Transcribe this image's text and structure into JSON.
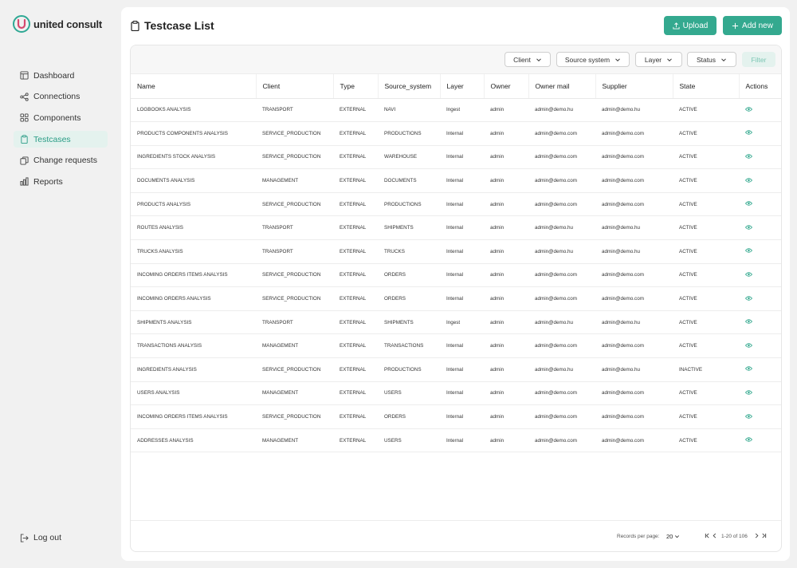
{
  "brand": {
    "name": "united consult",
    "accent": "#34a98f"
  },
  "sidebar": {
    "items": [
      {
        "label": "Dashboard",
        "icon": "layout-icon"
      },
      {
        "label": "Connections",
        "icon": "share-icon"
      },
      {
        "label": "Components",
        "icon": "grid-icon"
      },
      {
        "label": "Testcases",
        "icon": "clipboard-icon",
        "active": true
      },
      {
        "label": "Change requests",
        "icon": "copy-icon"
      },
      {
        "label": "Reports",
        "icon": "bar-chart-icon"
      }
    ],
    "logout": "Log out"
  },
  "header": {
    "title": "Testcase List",
    "upload_label": "Upload",
    "add_label": "Add new"
  },
  "filters": {
    "client": "Client",
    "source": "Source system",
    "layer": "Layer",
    "status": "Status",
    "filter": "Filter"
  },
  "table": {
    "columns": [
      "Name",
      "Client",
      "Type",
      "Source_system",
      "Layer",
      "Owner",
      "Owner mail",
      "Supplier",
      "State",
      "Actions"
    ],
    "rows": [
      [
        "LOGBOOKS ANALYSIS",
        "TRANSPORT",
        "EXTERNAL",
        "NAVI",
        "Ingest",
        "admin",
        "admin@demo.hu",
        "admin@demo.hu",
        "ACTIVE"
      ],
      [
        "PRODUCTS COMPONENTS ANALYSIS",
        "SERVICE_PRODUCTION",
        "EXTERNAL",
        "PRODUCTIONS",
        "Internal",
        "admin",
        "admin@demo.com",
        "admin@demo.com",
        "ACTIVE"
      ],
      [
        "INGREDIENTS STOCK ANALYSIS",
        "SERVICE_PRODUCTION",
        "EXTERNAL",
        "WAREHOUSE",
        "Internal",
        "admin",
        "admin@demo.com",
        "admin@demo.com",
        "ACTIVE"
      ],
      [
        "DOCUMENTS ANALYSIS",
        "MANAGEMENT",
        "EXTERNAL",
        "DOCUMENTS",
        "Internal",
        "admin",
        "admin@demo.com",
        "admin@demo.com",
        "ACTIVE"
      ],
      [
        "PRODUCTS ANALYSIS",
        "SERVICE_PRODUCTION",
        "EXTERNAL",
        "PRODUCTIONS",
        "Internal",
        "admin",
        "admin@demo.com",
        "admin@demo.com",
        "ACTIVE"
      ],
      [
        "ROUTES ANALYSIS",
        "TRANSPORT",
        "EXTERNAL",
        "SHIPMENTS",
        "Internal",
        "admin",
        "admin@demo.hu",
        "admin@demo.hu",
        "ACTIVE"
      ],
      [
        "TRUCKS ANALYSIS",
        "TRANSPORT",
        "EXTERNAL",
        "TRUCKS",
        "Internal",
        "admin",
        "admin@demo.hu",
        "admin@demo.hu",
        "ACTIVE"
      ],
      [
        "INCOMING ORDERS ITEMS ANALYSIS",
        "SERVICE_PRODUCTION",
        "EXTERNAL",
        "ORDERS",
        "Internal",
        "admin",
        "admin@demo.com",
        "admin@demo.com",
        "ACTIVE"
      ],
      [
        "INCOMING ORDERS ANALYSIS",
        "SERVICE_PRODUCTION",
        "EXTERNAL",
        "ORDERS",
        "Internal",
        "admin",
        "admin@demo.com",
        "admin@demo.com",
        "ACTIVE"
      ],
      [
        "SHIPMENTS ANALYSIS",
        "TRANSPORT",
        "EXTERNAL",
        "SHIPMENTS",
        "Ingest",
        "admin",
        "admin@demo.hu",
        "admin@demo.hu",
        "ACTIVE"
      ],
      [
        "TRANSACTIONS ANALYSIS",
        "MANAGEMENT",
        "EXTERNAL",
        "TRANSACTIONS",
        "Internal",
        "admin",
        "admin@demo.com",
        "admin@demo.com",
        "ACTIVE"
      ],
      [
        "INGREDIENTS ANALYSIS",
        "SERVICE_PRODUCTION",
        "EXTERNAL",
        "PRODUCTIONS",
        "Internal",
        "admin",
        "admin@demo.hu",
        "admin@demo.hu",
        "INACTIVE"
      ],
      [
        "USERS ANALYSIS",
        "MANAGEMENT",
        "EXTERNAL",
        "USERS",
        "Internal",
        "admin",
        "admin@demo.com",
        "admin@demo.com",
        "ACTIVE"
      ],
      [
        "INCOMING ORDERS ITEMS ANALYSIS",
        "SERVICE_PRODUCTION",
        "EXTERNAL",
        "ORDERS",
        "Internal",
        "admin",
        "admin@demo.com",
        "admin@demo.com",
        "ACTIVE"
      ],
      [
        "ADDRESSES ANALYSIS",
        "MANAGEMENT",
        "EXTERNAL",
        "USERS",
        "Internal",
        "admin",
        "admin@demo.com",
        "admin@demo.com",
        "ACTIVE"
      ]
    ]
  },
  "pagination": {
    "records_label": "Records per page:",
    "per_page": "20",
    "range": "1-20 of 106"
  }
}
